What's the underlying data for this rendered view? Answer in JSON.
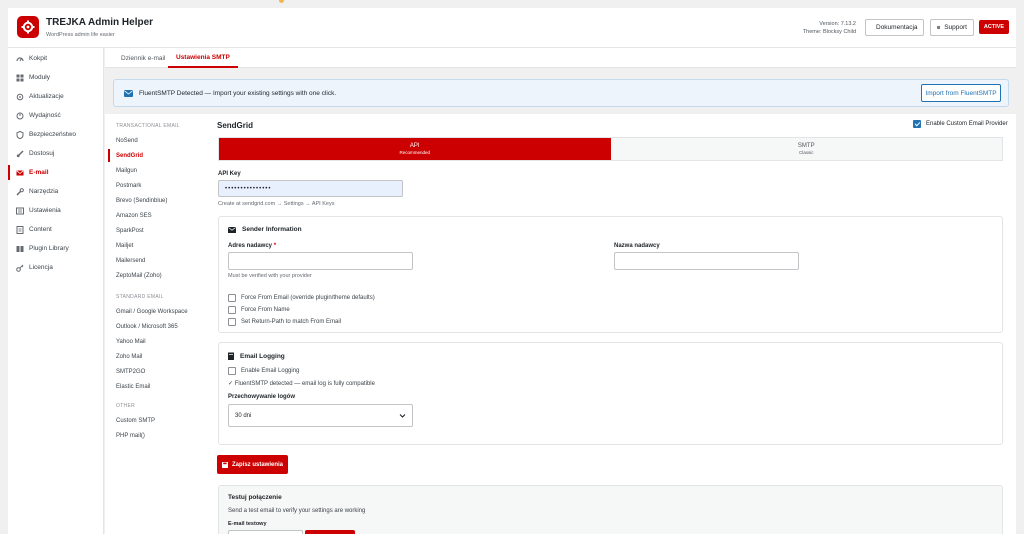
{
  "header": {
    "title": "TREJKA Admin Helper",
    "subtitle": "WordPress admin life easier",
    "version": "Version: 7.13.2",
    "theme": "Theme: Blocksy Child",
    "docs_label": "Dokumentacja",
    "support_label": "Support",
    "status_badge": "ACTIVE"
  },
  "sidebar": {
    "items": [
      {
        "label": "Kokpit",
        "icon": "dashboard-icon"
      },
      {
        "label": "Moduły",
        "icon": "modules-icon"
      },
      {
        "label": "Aktualizacje",
        "icon": "updates-icon"
      },
      {
        "label": "Wydajność",
        "icon": "performance-icon"
      },
      {
        "label": "Bezpieczeństwo",
        "icon": "shield-icon"
      },
      {
        "label": "Dostosuj",
        "icon": "brush-icon"
      },
      {
        "label": "E-mail",
        "icon": "email-icon",
        "active": true
      },
      {
        "label": "Narzędzia",
        "icon": "tools-icon"
      },
      {
        "label": "Ustawienia",
        "icon": "settings-icon"
      },
      {
        "label": "Content",
        "icon": "content-icon"
      },
      {
        "label": "Plugin Library",
        "icon": "library-icon"
      },
      {
        "label": "Licencja",
        "icon": "key-icon"
      }
    ]
  },
  "tabs": [
    {
      "label": "Dziennik e-mail"
    },
    {
      "label": "Ustawienia SMTP",
      "active": true
    }
  ],
  "notice": {
    "text": "FluentSMTP Detected — Import your existing settings with one click.",
    "button": "Import from FluentSMTP"
  },
  "providers": {
    "transactional_heading": "TRANSACTIONAL EMAIL",
    "transactional": [
      "NoSend",
      "SendGrid",
      "Mailgun",
      "Postmark",
      "Brevo (Sendinblue)",
      "Amazon SES",
      "SparkPost",
      "Mailjet",
      "Mailersend",
      "ZeptoMail (Zoho)"
    ],
    "standard_heading": "STANDARD EMAIL",
    "standard": [
      "Gmail / Google Workspace",
      "Outlook / Microsoft 365",
      "Yahoo Mail",
      "Zoho Mail",
      "SMTP2GO",
      "Elastic Email"
    ],
    "other_heading": "OTHER",
    "other": [
      "Custom SMTP",
      "PHP mail()"
    ],
    "selected": "SendGrid"
  },
  "main": {
    "title": "SendGrid",
    "enable_provider_label": "Enable Custom Email Provider",
    "enable_provider_checked": true,
    "mode": {
      "api_label": "API",
      "api_sub": "Recommended",
      "smtp_label": "SMTP",
      "smtp_sub": "Classic"
    },
    "api_key_label": "API Key",
    "api_key_value": "•••••••••••••••",
    "api_key_hint": "Create at sendgrid.com → Settings → API Keys",
    "sender": {
      "title": "Sender Information",
      "from_email_label": "Adres nadawcy",
      "required_mark": "*",
      "from_email_value": "",
      "from_email_hint": "Must be verified with your provider",
      "from_name_label": "Nazwa nadawcy",
      "from_name_value": "",
      "checkboxes": [
        {
          "label": "Force From Email (override plugin/theme defaults)"
        },
        {
          "label": "Force From Name"
        },
        {
          "label": "Set Return-Path to match From Email"
        }
      ]
    },
    "logging": {
      "title": "Email Logging",
      "enable_label": "Enable Email Logging",
      "status": "✓ FluentSMTP detected — email log is fully compatible",
      "retention_label": "Przechowywanie logów",
      "retention_value": "30 dni"
    },
    "save_button": "Zapisz ustawienia",
    "test": {
      "title": "Testuj połączenie",
      "subtitle": "Send a test email to verify your settings are working",
      "email_label": "E-mail testowy"
    }
  },
  "colors": {
    "accent": "#cc0000",
    "link": "#2271b1"
  }
}
